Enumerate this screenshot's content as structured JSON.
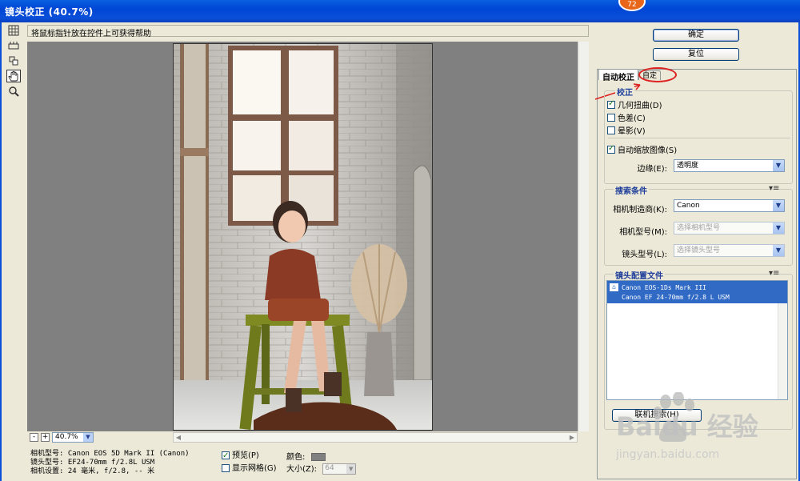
{
  "window": {
    "title": "镜头校正 (40.7%)",
    "badge": "72"
  },
  "hint": "将鼠标指针放在控件上可获得帮助",
  "tools": [
    {
      "name": "remove-distortion-icon"
    },
    {
      "name": "straighten-icon"
    },
    {
      "name": "move-grid-icon"
    },
    {
      "name": "hand-icon"
    },
    {
      "name": "zoom-icon"
    }
  ],
  "zoom": {
    "minus": "-",
    "plus": "+",
    "value": "40.7%"
  },
  "info": {
    "camera": "相机型号: Canon EOS 5D Mark II (Canon)",
    "lens": "镜头型号: EF24-70mm f/2.8L USM",
    "settings": "相机设置: 24 毫米, f/2.8, -- 米"
  },
  "options": {
    "preview": "预览(P)",
    "preview_checked": true,
    "grid": "显示网格(G)",
    "grid_checked": false,
    "color_label": "颜色:",
    "size_label": "大小(Z):",
    "size_value": "64"
  },
  "buttons": {
    "ok": "确定",
    "reset": "复位",
    "online_search": "联机搜索(H)"
  },
  "tabs": {
    "auto": "自动校正",
    "custom": "自定"
  },
  "correction": {
    "title": "校正",
    "geometric": "几何扭曲(D)",
    "geometric_checked": true,
    "chromatic": "色差(C)",
    "chromatic_checked": false,
    "vignette": "晕影(V)",
    "vignette_checked": false,
    "autoscale": "自动缩放图像(S)",
    "autoscale_checked": true,
    "edge_label": "边缘(E):",
    "edge_value": "透明度"
  },
  "search": {
    "title": "搜索条件",
    "maker_label": "相机制造商(K):",
    "maker_value": "Canon",
    "camera_label": "相机型号(M):",
    "camera_placeholder": "选择相机型号",
    "lens_label": "镜头型号(L):",
    "lens_placeholder": "选择镜头型号"
  },
  "profiles": {
    "title": "镜头配置文件",
    "items": [
      {
        "camera": "Canon EOS-1Ds Mark III",
        "lens": "Canon EF 24-70mm f/2.8 L USM"
      }
    ]
  },
  "watermark": {
    "brand": "Baidu 经验",
    "url": "jingyan.baidu.com"
  }
}
